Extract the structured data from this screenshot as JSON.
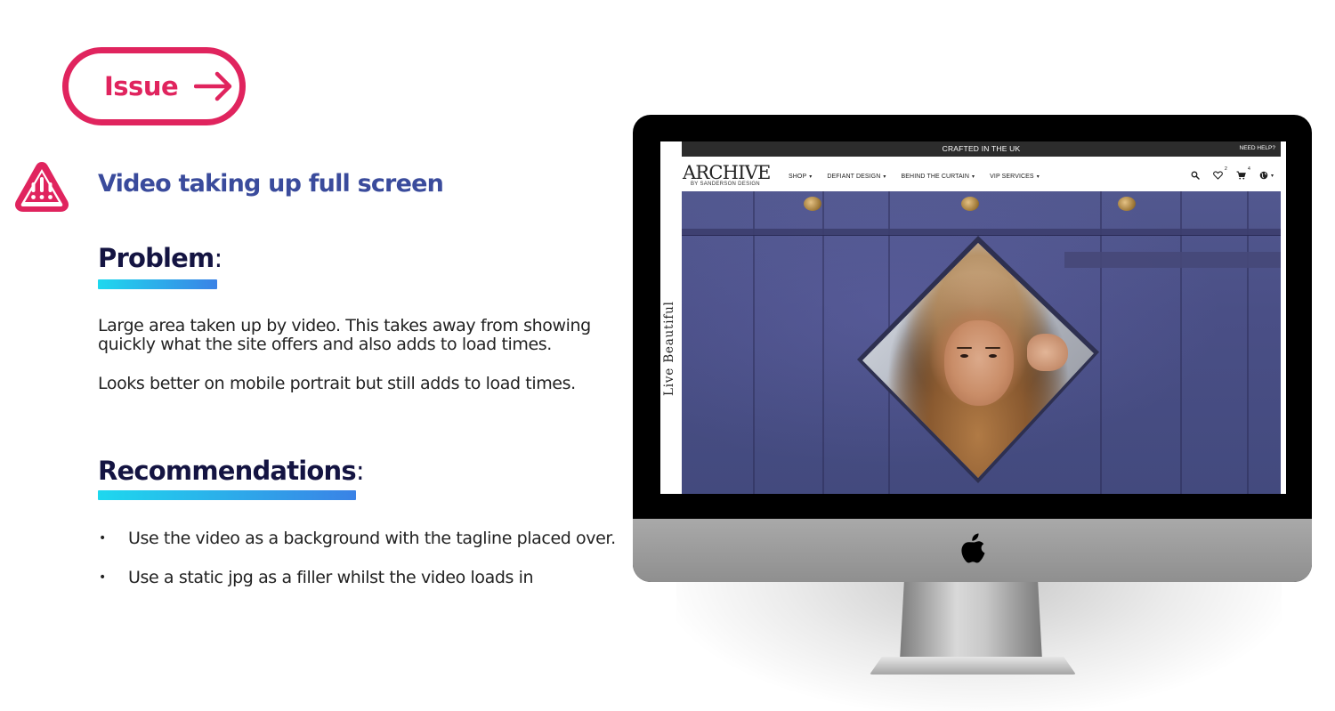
{
  "issue_button": {
    "label": "Issue"
  },
  "issue_title": "Video taking up full screen",
  "problem": {
    "heading": "Problem",
    "paragraphs": [
      "Large area taken up by video. This takes away from showing quickly what the site offers and also adds to load times.",
      "Looks better on mobile portrait but still adds to load times."
    ]
  },
  "recommendations": {
    "heading": "Recommendations",
    "items": [
      "Use the video as a background with the tagline placed over.",
      "Use a static jpg as a filler whilst the video loads in"
    ]
  },
  "colors": {
    "accent_pink": "#e0245e",
    "title_blue": "#3a4b9c",
    "heading_navy": "#141442",
    "gradient_start": "#1ed8ee",
    "gradient_end": "#3a82e6"
  },
  "website": {
    "top_banner": "CRAFTED IN THE UK",
    "help_link": "NEED HELP?",
    "logo": {
      "main": "ARCHIVE",
      "sub": "BY SANDERSON DESIGN"
    },
    "nav": [
      {
        "label": "SHOP"
      },
      {
        "label": "DEFIANT DESIGN"
      },
      {
        "label": "BEHIND THE CURTAIN"
      },
      {
        "label": "VIP SERVICES"
      }
    ],
    "wishlist_count": "2",
    "cart_count": "4",
    "side_tagline": "Live Beautiful",
    "icons": [
      "search-icon",
      "heart-icon",
      "cart-icon",
      "globe-icon"
    ]
  }
}
